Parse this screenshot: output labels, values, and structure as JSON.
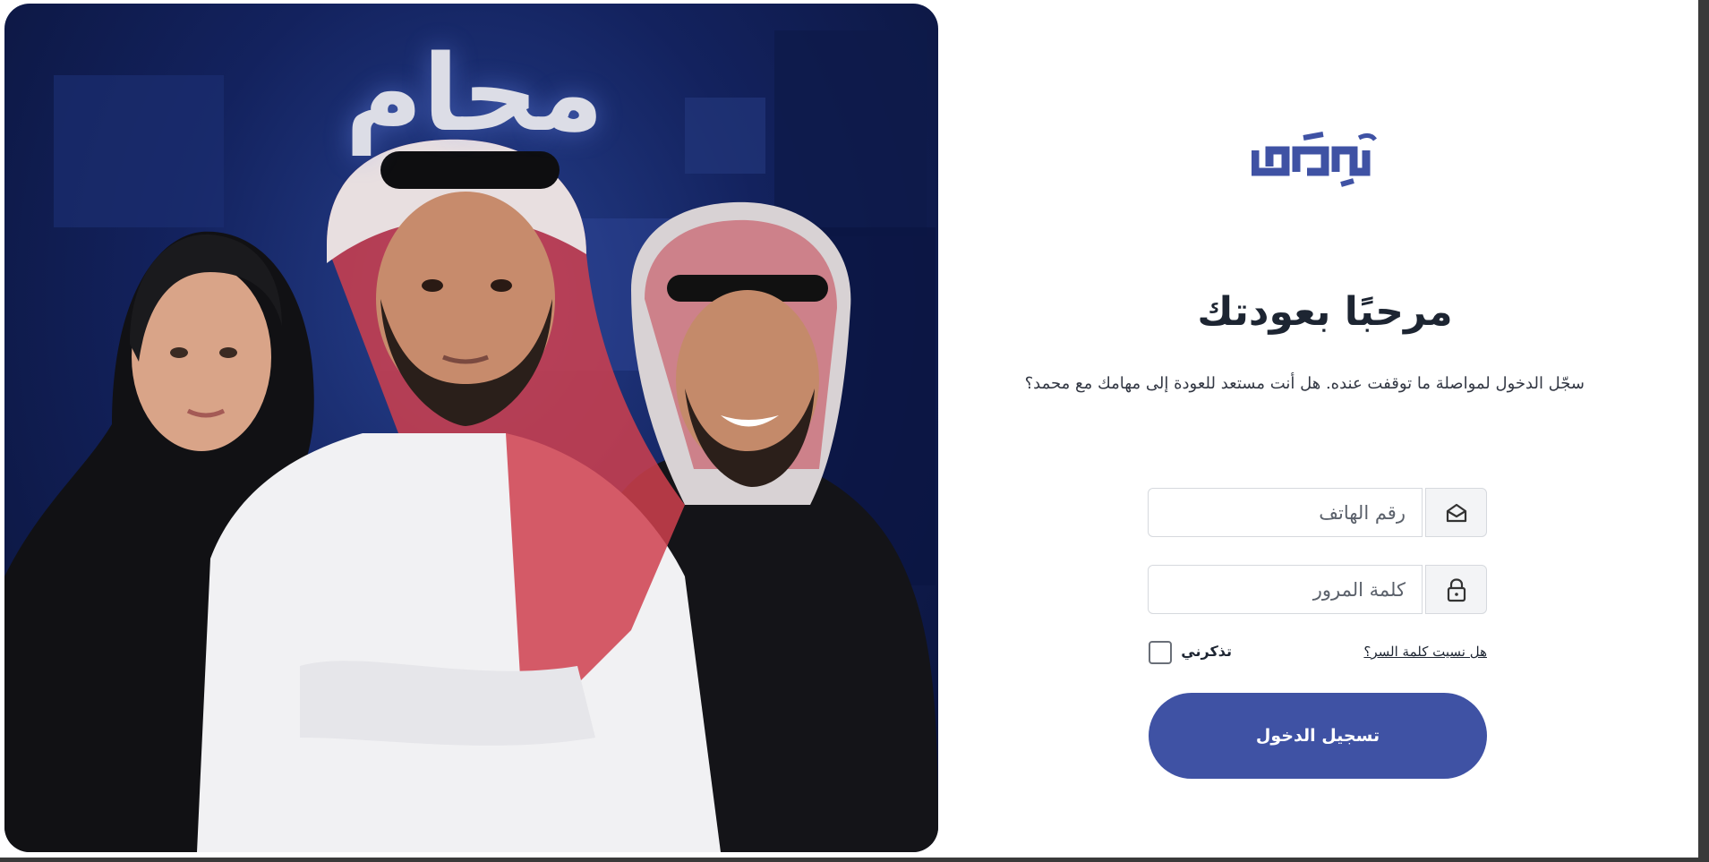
{
  "hero": {
    "brand_text": "محام",
    "image_description_icon": "people-photo"
  },
  "logo": {
    "icon": "mohami-logo-icon",
    "color": "#3f52a4"
  },
  "login": {
    "heading": "مرحبًا بعودتك",
    "subtitle": "سجّل الدخول لمواصلة ما توقفت عنده. هل أنت مستعد للعودة إلى مهامك مع محمد؟",
    "phone_placeholder": "رقم الهاتف",
    "phone_value": "",
    "phone_icon": "envelope-open-icon",
    "password_placeholder": "كلمة المرور",
    "password_value": "",
    "password_icon": "lock-icon",
    "forgot_password": "هل نسيت كلمة السر؟",
    "remember_me": "تذكرني",
    "remember_checked": false,
    "submit_label": "تسجيل الدخول"
  },
  "colors": {
    "accent": "#3f52a4",
    "heading": "#1d2532",
    "hero_bg": "#13225e"
  }
}
